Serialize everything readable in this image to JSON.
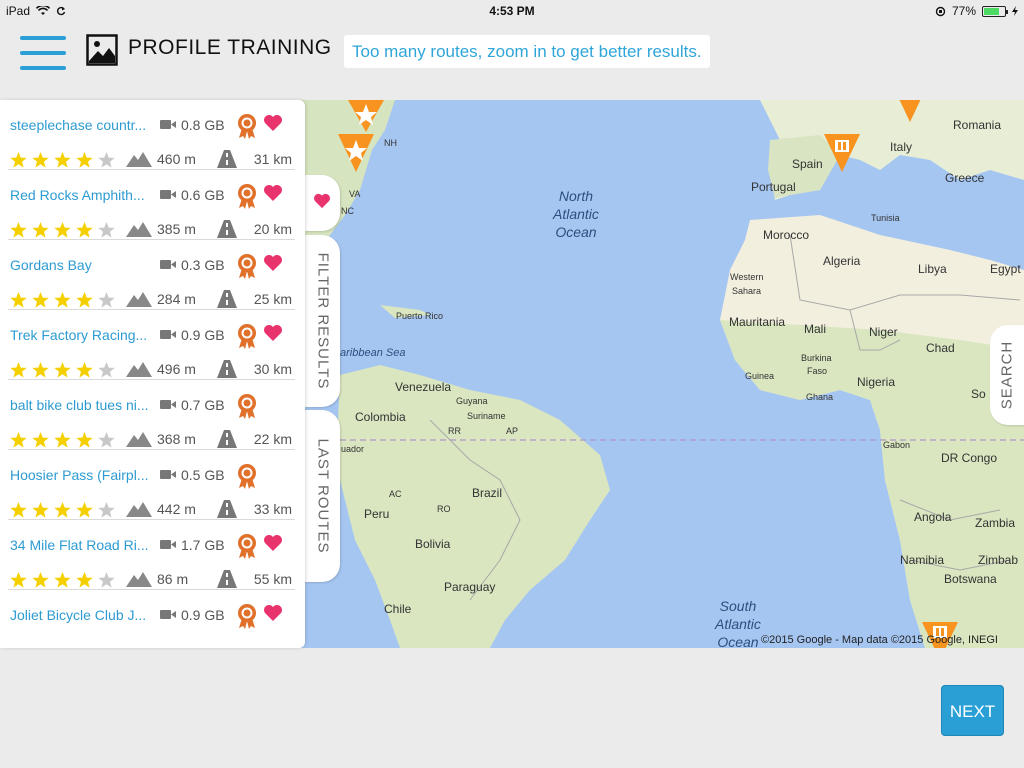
{
  "status_bar": {
    "device": "iPad",
    "time": "4:53 PM",
    "battery_percent": "77%",
    "battery_level": 0.77
  },
  "header": {
    "title": "PROFILE TRAINING",
    "banner": "Too many routes, zoom in to get better results."
  },
  "routes": [
    {
      "name": "steeplechase countr...",
      "size": "0.8 GB",
      "rating": 4,
      "elevation": "460 m",
      "distance": "31 km",
      "favorite": true
    },
    {
      "name": "Red Rocks Amphith...",
      "size": "0.6 GB",
      "rating": 4,
      "elevation": "385 m",
      "distance": "20 km",
      "favorite": true
    },
    {
      "name": "Gordans Bay",
      "size": "0.3 GB",
      "rating": 4,
      "elevation": "284 m",
      "distance": "25 km",
      "favorite": true
    },
    {
      "name": "Trek Factory Racing...",
      "size": "0.9 GB",
      "rating": 4,
      "elevation": "496 m",
      "distance": "30 km",
      "favorite": true
    },
    {
      "name": "balt bike club tues ni...",
      "size": "0.7 GB",
      "rating": 4,
      "elevation": "368 m",
      "distance": "22 km",
      "favorite": false
    },
    {
      "name": "Hoosier Pass (Fairpl...",
      "size": "0.5 GB",
      "rating": 4,
      "elevation": "442 m",
      "distance": "33 km",
      "favorite": false
    },
    {
      "name": "34 Mile Flat Road Ri...",
      "size": "1.7 GB",
      "rating": 4,
      "elevation": "86 m",
      "distance": "55 km",
      "favorite": true
    },
    {
      "name": "Joliet Bicycle Club J...",
      "size": "0.9 GB",
      "rating": 4,
      "elevation": "",
      "distance": "",
      "favorite": true
    }
  ],
  "tabs": {
    "filter": "FILTER RESULTS",
    "last": "LAST ROUTES",
    "search": "SEARCH"
  },
  "map": {
    "copyright": "©2015 Google - Map data ©2015 Google, INEGI",
    "labels": {
      "romania": "Romania",
      "nh": "NH",
      "italy": "Italy",
      "spain": "Spain",
      "portugal": "Portugal",
      "greece": "Greece",
      "north_atlantic_1": "North",
      "north_atlantic_2": "Atlantic",
      "north_atlantic_3": "Ocean",
      "tunisia": "Tunisia",
      "va": "VA",
      "nc": "NC",
      "morocco": "Morocco",
      "algeria": "Algeria",
      "libya": "Libya",
      "egypt": "Egypt",
      "western_sahara_1": "Western",
      "western_sahara_2": "Sahara",
      "mauritania": "Mauritania",
      "mali": "Mali",
      "niger": "Niger",
      "chad": "Chad",
      "puerto_rico": "Puerto Rico",
      "caribbean_sea": "aribbean Sea",
      "burkina_1": "Burkina",
      "burkina_2": "Faso",
      "guinea": "Guinea",
      "nigeria": "Nigeria",
      "ghana": "Ghana",
      "venezuela": "Venezuela",
      "guyana": "Guyana",
      "suriname": "Suriname",
      "colombia": "Colombia",
      "rr": "RR",
      "ap": "AP",
      "ecuador": "uador",
      "gabon": "Gabon",
      "dr_congo": "DR Congo",
      "brazil": "Brazil",
      "ac": "AC",
      "peru": "Peru",
      "ro": "RO",
      "bolivia": "Bolivia",
      "angola": "Angola",
      "zambia": "Zambia",
      "namibia": "Namibia",
      "zimbabwe": "Zimbab",
      "botswana": "Botswana",
      "paraguay": "Paraguay",
      "chile": "Chile",
      "south_atlantic_1": "South",
      "south_atlantic_2": "Atlantic",
      "south_atlantic_3": "Ocean",
      "somalia": "So"
    }
  },
  "buttons": {
    "next": "NEXT"
  },
  "colors": {
    "accent": "#2b9fd8",
    "pin": "#f7931e",
    "heart": "#e8336d",
    "badge": "#e0702a",
    "star": "#f5d000"
  }
}
